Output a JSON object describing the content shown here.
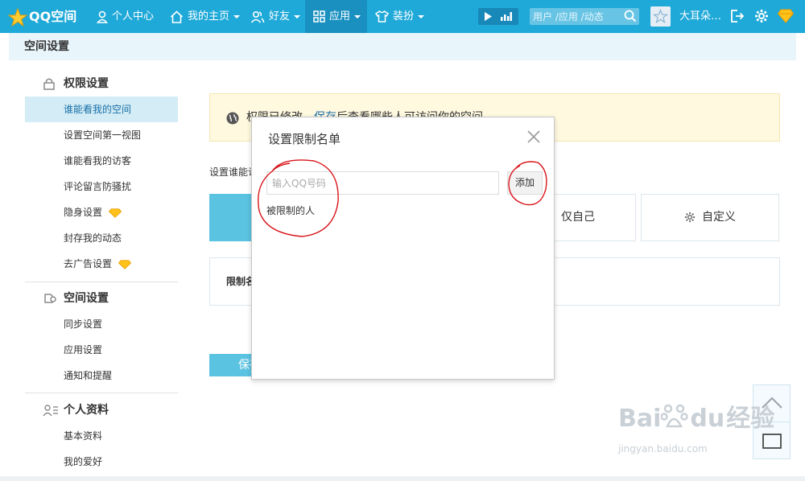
{
  "nav": {
    "logo": "QQ空间",
    "items": [
      {
        "label": "个人中心",
        "icon": "person-icon"
      },
      {
        "label": "我的主页",
        "icon": "home-icon"
      },
      {
        "label": "好友",
        "icon": "friends-icon"
      },
      {
        "label": "应用",
        "icon": "apps-grid-icon"
      },
      {
        "label": "装扮",
        "icon": "shirt-icon"
      }
    ],
    "search_placeholder": "用户 /应用 /动态",
    "username": "大耳朵…"
  },
  "page": {
    "title": "空间设置"
  },
  "sidebar": {
    "sections": [
      {
        "title": "权限设置",
        "icon": "lock-icon",
        "items": [
          {
            "label": "谁能看我的空间",
            "active": true
          },
          {
            "label": "设置空间第一视图"
          },
          {
            "label": "谁能看我的访客"
          },
          {
            "label": "评论留言防骚扰"
          },
          {
            "label": "隐身设置",
            "vip": true
          },
          {
            "label": "封存我的动态"
          },
          {
            "label": "去广告设置",
            "vip": true
          }
        ]
      },
      {
        "title": "空间设置",
        "icon": "space-settings-icon",
        "items": [
          {
            "label": "同步设置"
          },
          {
            "label": "应用设置"
          },
          {
            "label": "通知和提醒"
          }
        ]
      },
      {
        "title": "个人资料",
        "icon": "profile-card-icon",
        "items": [
          {
            "label": "基本资料"
          },
          {
            "label": "我的爱好"
          }
        ]
      }
    ]
  },
  "main": {
    "notice": {
      "prefix": "权限已修改，",
      "link": "保存",
      "suffix": "后查看哪些人可访问你的空间"
    },
    "set_label": "设置谁能访问",
    "options": [
      {
        "label": "",
        "selected": true
      },
      {
        "label": "仅自己"
      },
      {
        "label": "自定义",
        "icon": "gear-icon"
      }
    ],
    "limit_label": "限制名单",
    "save_label": "保存"
  },
  "modal": {
    "title": "设置限制名单",
    "input_placeholder": "输入QQ号码",
    "add_label": "添加",
    "restricted_label": "被限制的人"
  },
  "watermark": {
    "brand": "Bai",
    "brand2": "经验",
    "url": "jingyan.baidu.com"
  },
  "colors": {
    "nav_bg": "#1fa9d8",
    "accent": "#5bc3e2",
    "annotation": "#d8151b"
  }
}
